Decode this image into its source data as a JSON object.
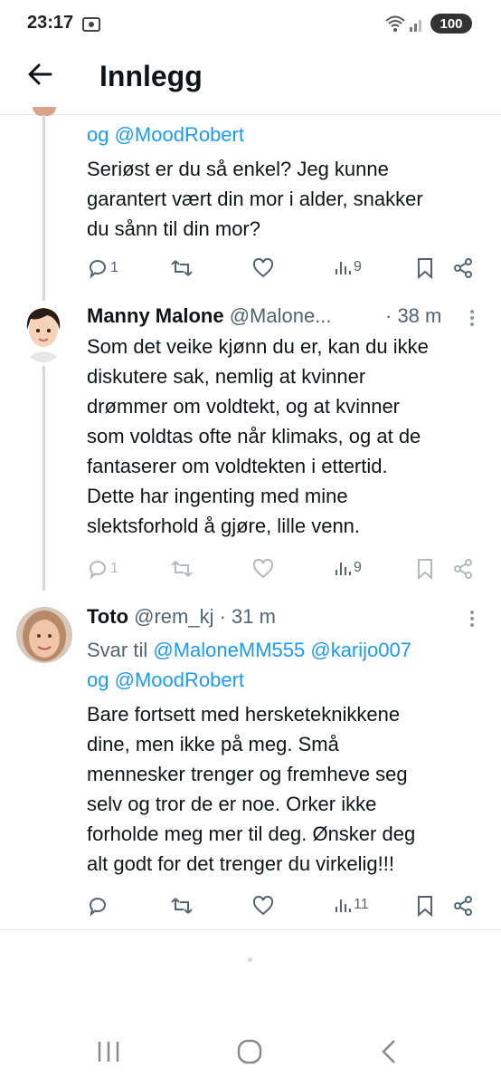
{
  "status_bar": {
    "time": "23:17",
    "battery": "100"
  },
  "header": {
    "title": "Innlegg"
  },
  "tweet1": {
    "reply_tail": "og @MoodRobert",
    "body": [
      "Seriøst er du så enkel? Jeg kunne",
      "garantert vært din mor i alder, snakker",
      "du sånn til din mor?"
    ],
    "replies": "1",
    "views": "9"
  },
  "tweet2": {
    "name": "Manny Malone",
    "handle": "@Malone...",
    "time": "· 38 m",
    "body": [
      "Som det veike kjønn du er, kan du ikke",
      "diskutere sak, nemlig at kvinner",
      "drømmer om voldtekt, og at kvinner",
      "som voldtas ofte når klimaks, og at de",
      "fantaserer om voldtekten i ettertid.",
      "Dette har ingenting med mine",
      "slektsforhold å gjøre, lille venn."
    ],
    "replies": "1",
    "views": "9"
  },
  "tweet3": {
    "name": "Toto",
    "handle": "@rem_kj",
    "time": "· 31 m",
    "reply_prefix": "Svar til",
    "reply_to": [
      "@MaloneMM555",
      "@karijo007"
    ],
    "reply_and": "og",
    "reply_to_last": "@MoodRobert",
    "body": [
      "Bare fortsett med hersketeknikkene",
      "dine, men ikke på meg. Små",
      "mennesker trenger og fremheve seg",
      "selv og tror de er noe. Orker ikke",
      "forholde meg mer til deg. Ønsker deg",
      "alt godt for det trenger du virkelig!!!"
    ],
    "views": "11"
  },
  "nav": {
    "recents": "|||",
    "home": "○",
    "back": "‹"
  }
}
